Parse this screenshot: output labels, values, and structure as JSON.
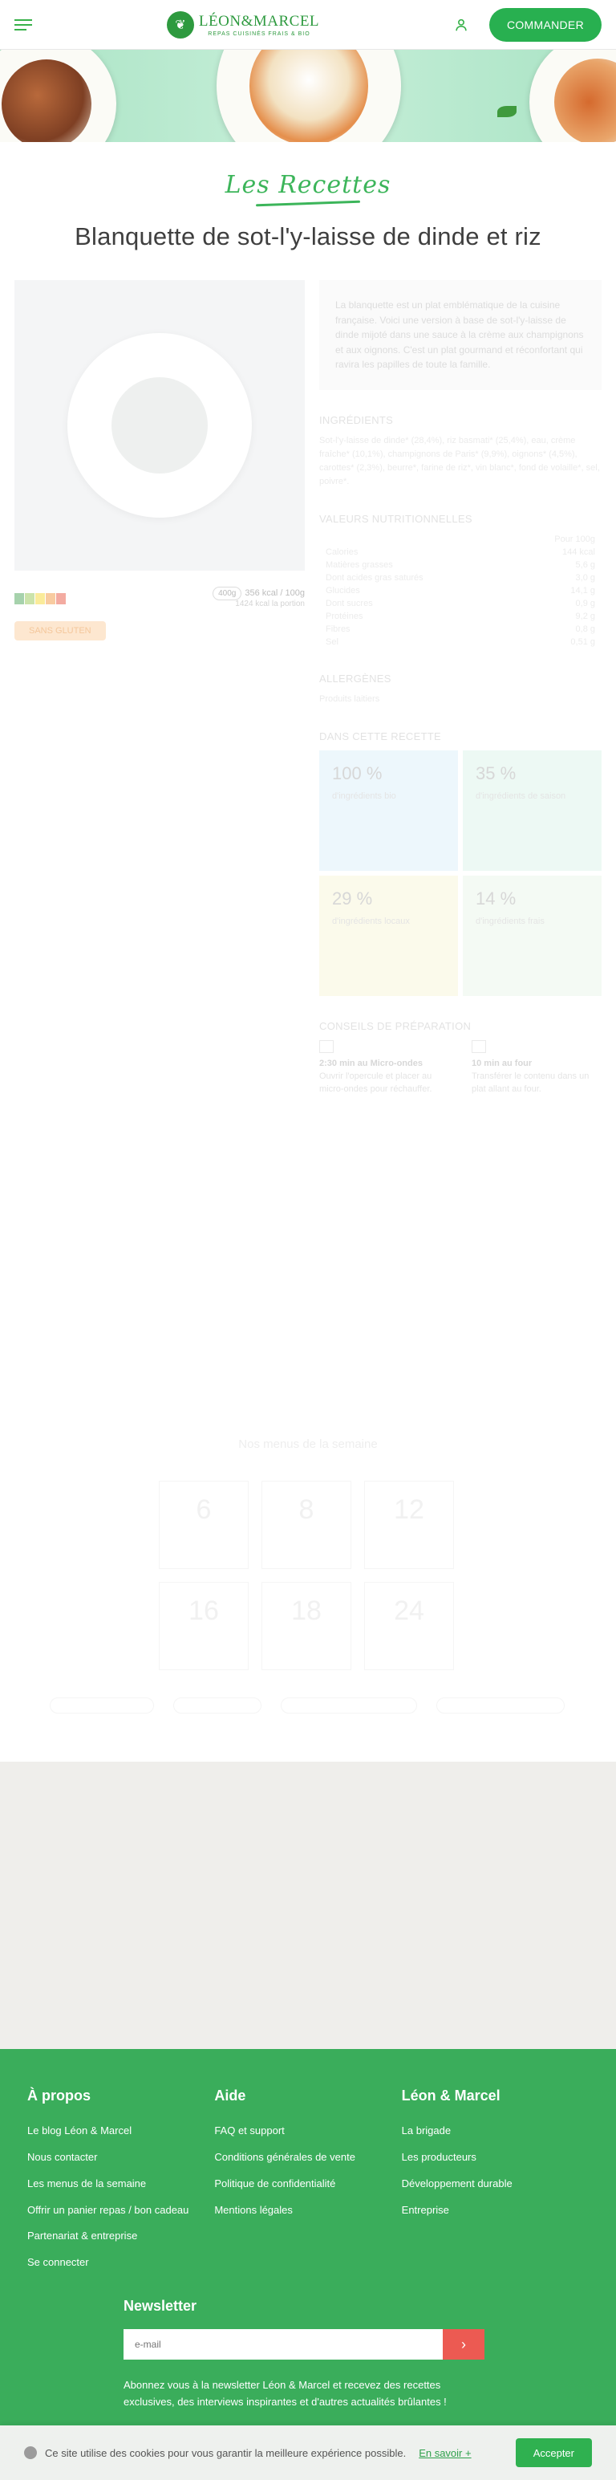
{
  "header": {
    "brand": "LÉON&MARCEL",
    "tagline": "REPAS CUISINÉS FRAIS & BIO",
    "order_button": "COMMANDER"
  },
  "recipe": {
    "section_label": "Les Recettes",
    "title": "Blanquette de sot-l'y-laisse de dinde et riz",
    "description": "La blanquette est un plat emblématique de la cuisine française. Voici une version à base de sot-l'y-laisse de dinde mijoté dans une sauce à la crème aux champignons et aux oignons. C'est un plat gourmand et réconfortant qui ravira les papilles de toute la famille.",
    "weight": "400g",
    "kcal": "356 kcal / 100g",
    "kcal_sub": "1424 kcal la portion",
    "tag": "SANS GLUTEN",
    "nutri_colors": [
      "#3a9b48",
      "#8cc043",
      "#f4d21e",
      "#ef8b2c",
      "#e4442e"
    ]
  },
  "sections": {
    "ingredients_title": "INGRÉDIENTS",
    "ingredients_text": "Sot-l'y-laisse de dinde* (28,4%), riz basmati* (25,4%), eau, crème fraîche* (10,1%), champignons de Paris* (9,9%), oignons* (4,5%), carottes* (2,3%), beurre*, farine de riz*, vin blanc*, fond de volaille*, sel, poivre*.",
    "nutrition_title": "VALEURS NUTRITIONNELLES",
    "nutrition_header": "Pour 100g",
    "nutrition": [
      {
        "label": "Calories",
        "value": "144 kcal"
      },
      {
        "label": "Matières grasses",
        "value": "5,6 g"
      },
      {
        "label": "Dont acides gras saturés",
        "value": "3,0 g"
      },
      {
        "label": "Glucides",
        "value": "14,1 g"
      },
      {
        "label": "Dont sucres",
        "value": "0,9 g"
      },
      {
        "label": "Protéines",
        "value": "9,2 g"
      },
      {
        "label": "Fibres",
        "value": "0,8 g"
      },
      {
        "label": "Sel",
        "value": "0,51 g"
      }
    ],
    "allergens_title": "ALLERGÈNES",
    "allergens_text": "Produits laitiers",
    "in_recipe_title": "DANS CETTE RECETTE",
    "stats": [
      {
        "pct": "100 %",
        "label": "d'ingrédients bio",
        "color": "#d4ecfa"
      },
      {
        "pct": "35 %",
        "label": "d'ingrédients de saison",
        "color": "#d3f1e4"
      },
      {
        "pct": "29 %",
        "label": "d'ingrédients locaux",
        "color": "#f6f3cf"
      },
      {
        "pct": "14 %",
        "label": "d'ingrédients frais",
        "color": "#e6f3e4"
      }
    ],
    "prep_title": "CONSEILS DE PRÉPARATION",
    "prep": [
      {
        "title": "2:30 min au Micro-ondes",
        "text": "Ouvrir l'opercule et placer au micro-ondes pour réchauffer."
      },
      {
        "title": "10 min au four",
        "text": "Transférer le contenu dans un plat allant au four."
      }
    ]
  },
  "calendar": {
    "title": "Nos menus de la semaine",
    "days": [
      "6",
      "8",
      "12",
      "16",
      "18",
      "24"
    ]
  },
  "footer": {
    "about_title": "À propos",
    "about_links": [
      "Le blog Léon & Marcel",
      "Nous contacter",
      "Les menus de la semaine",
      "Offrir un panier repas / bon cadeau",
      "Partenariat & entreprise",
      "Se connecter"
    ],
    "help_title": "Aide",
    "help_links": [
      "FAQ et support",
      "Conditions générales de vente",
      "Politique de confidentialité",
      "Mentions légales"
    ],
    "lm_title": "Léon & Marcel",
    "lm_links": [
      "La brigade",
      "Les producteurs",
      "Développement durable",
      "Entreprise"
    ],
    "newsletter_title": "Newsletter",
    "newsletter_placeholder": "e-mail",
    "newsletter_text": "Abonnez vous à la newsletter Léon & Marcel et recevez des recettes exclusives, des interviews inspirantes et d'autres actualités brûlantes !"
  },
  "cookie": {
    "text": "Ce site utilise des cookies pour vous garantir la meilleure expérience possible.",
    "link": "En savoir +",
    "accept": "Accepter"
  }
}
